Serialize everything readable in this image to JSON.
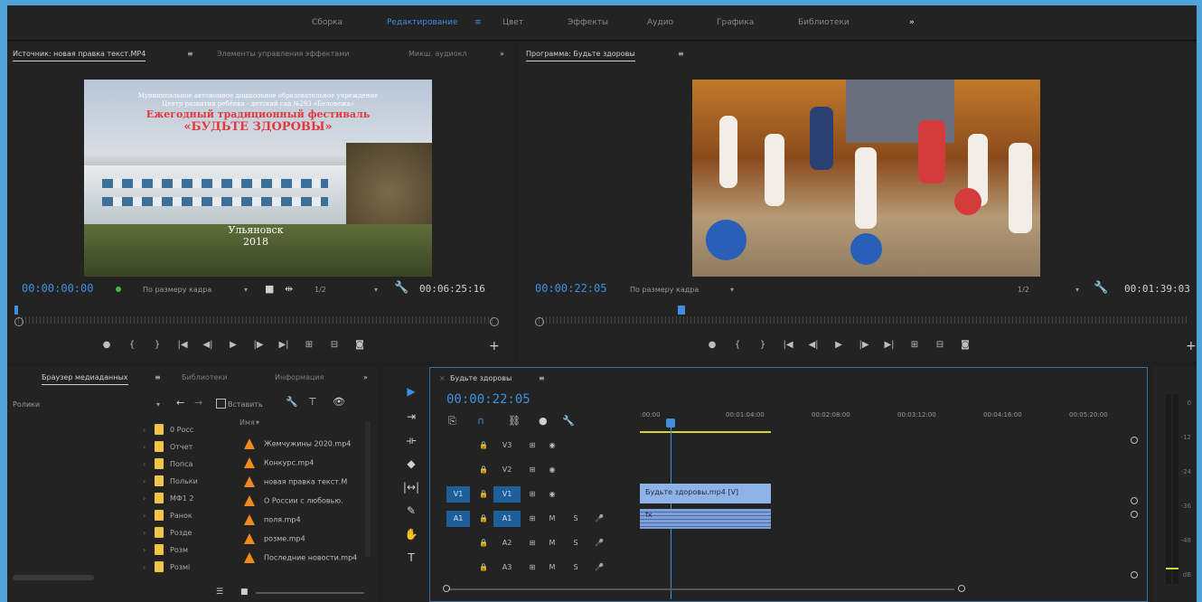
{
  "workspaces": [
    {
      "label": "Сборка",
      "active": false
    },
    {
      "label": "Редактирование",
      "active": true
    },
    {
      "label": "Цвет",
      "active": false
    },
    {
      "label": "Эффекты",
      "active": false
    },
    {
      "label": "Аудио",
      "active": false
    },
    {
      "label": "Графика",
      "active": false
    },
    {
      "label": "Библиотеки",
      "active": false
    }
  ],
  "source": {
    "tabs": [
      "Источник: новая правка текст.MP4",
      "Элементы управления эффектами",
      "Микш. аудиокл"
    ],
    "timecode": "00:00:00:00",
    "fit": "По размеру кадра",
    "resolution": "1/2",
    "duration": "00:06:25:16",
    "image": {
      "line1": "Муниципальное автономное дошкольное образовательное учреждение",
      "line2": "Центр развития ребёнка - детский сад №293 «Беловежа»",
      "line3": "Ежегодный традиционный фестиваль",
      "line4": "«БУДЬТЕ ЗДОРОВЫ»",
      "city": "Ульяновск",
      "year": "2018"
    }
  },
  "program": {
    "tab": "Программа: Будьте здоровы",
    "timecode": "00:00:22:05",
    "fit": "По размеру кадра",
    "resolution": "1/2",
    "duration": "00:01:39:03"
  },
  "project": {
    "tabs": [
      "Браузер медиаданных",
      "Библиотеки",
      "Информация"
    ],
    "location": "Ролики",
    "insert_label": "Вставить",
    "column": "Имя",
    "bins": [
      "0 Росс",
      "Отчет",
      "Попса",
      "Польки",
      "МФ1 2",
      "Ранок",
      "Розде",
      "Розм",
      "Розмі"
    ],
    "files": [
      "Жемчужины 2020.mp4",
      "Конкурс.mp4",
      "новая правка текст.M",
      "О России с любовью.",
      "поля.mp4",
      "розме.mp4",
      "Последние новости.mp4"
    ]
  },
  "timeline": {
    "tab": "Будьте здоровы",
    "timecode": "00:00:22:05",
    "ruler": [
      ":00:00",
      "00:01:04:00",
      "00:02:08:00",
      "00:03:12:00",
      "00:04:16:00",
      "00:05:20:00"
    ],
    "tracks": [
      {
        "src": "",
        "label": "V3",
        "type": "video"
      },
      {
        "src": "",
        "label": "V2",
        "type": "video"
      },
      {
        "src": "V1",
        "label": "V1",
        "type": "video"
      },
      {
        "src": "A1",
        "label": "A1",
        "type": "audio"
      },
      {
        "src": "",
        "label": "A2",
        "type": "audio"
      },
      {
        "src": "",
        "label": "A3",
        "type": "audio"
      }
    ],
    "clip_label": "Будьте здоровы.mp4 [V]",
    "audio_clip_label": "fx"
  },
  "meter": [
    "0",
    "-12",
    "-24",
    "-36",
    "-48",
    "dB"
  ],
  "colors": {
    "accent": "#3f8fe0",
    "folder": "#f0c34a",
    "clip_video": "#8fb3e6",
    "clip_audio": "#7fa0d8"
  }
}
